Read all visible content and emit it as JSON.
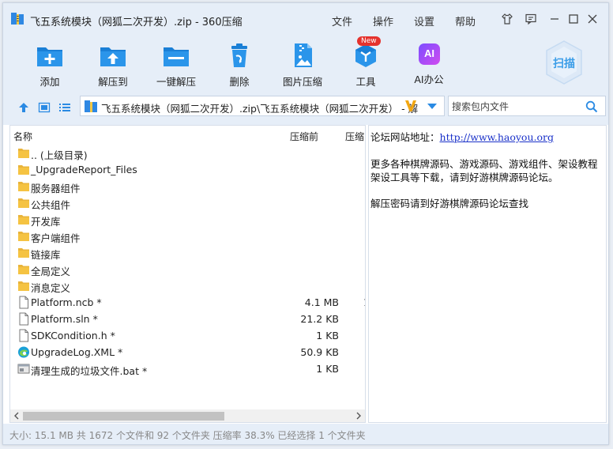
{
  "window": {
    "title": "飞五系统模块（网狐二次开发）.zip - 360压缩",
    "menus": [
      "文件",
      "操作",
      "设置",
      "帮助"
    ]
  },
  "toolbar": {
    "items": [
      {
        "label": "添加",
        "icon": "add-icon"
      },
      {
        "label": "解压到",
        "icon": "extract-to-icon"
      },
      {
        "label": "一键解压",
        "icon": "one-click-extract-icon"
      },
      {
        "label": "删除",
        "icon": "trash-icon"
      },
      {
        "label": "图片压缩",
        "icon": "image-compress-icon"
      },
      {
        "label": "工具",
        "icon": "tools-icon",
        "badge": "New"
      },
      {
        "label": "AI办公",
        "icon": "ai-office-icon",
        "icon_text": "AI"
      }
    ],
    "scan_label": "扫描"
  },
  "address": {
    "path": "飞五系统模块（网狐二次开发）.zip\\飞五系统模块（网狐二次开发） - 解",
    "search_placeholder": "搜索包内文件"
  },
  "file_list": {
    "columns": [
      "名称",
      "压缩前",
      "压缩"
    ],
    "rows": [
      {
        "name": ".. (上级目录)",
        "size": "",
        "type": "folder"
      },
      {
        "name": "_UpgradeReport_Files",
        "size": "",
        "type": "folder"
      },
      {
        "name": "服务器组件",
        "size": "",
        "type": "folder"
      },
      {
        "name": "公共组件",
        "size": "",
        "type": "folder"
      },
      {
        "name": "开发库",
        "size": "",
        "type": "folder"
      },
      {
        "name": "客户端组件",
        "size": "",
        "type": "folder"
      },
      {
        "name": "链接库",
        "size": "",
        "type": "folder"
      },
      {
        "name": "全局定义",
        "size": "",
        "type": "folder"
      },
      {
        "name": "消息定义",
        "size": "",
        "type": "folder"
      },
      {
        "name": "Platform.ncb *",
        "size": "4.1 MB",
        "type": "file",
        "cut": "1"
      },
      {
        "name": "Platform.sln *",
        "size": "21.2 KB",
        "type": "file"
      },
      {
        "name": "SDKCondition.h *",
        "size": "1 KB",
        "type": "file"
      },
      {
        "name": "UpgradeLog.XML *",
        "size": "50.9 KB",
        "type": "edge"
      },
      {
        "name": "清理生成的垃圾文件.bat *",
        "size": "1 KB",
        "type": "bat"
      }
    ]
  },
  "info_panel": {
    "forum_label": "论坛网站地址：",
    "forum_url": "http://www.haoyou.org",
    "line2": "更多各种棋牌源码、游戏源码、游戏组件、架设教程",
    "line3": "架设工具等下载，请到好游棋牌源码论坛。",
    "line4": "解压密码请到好游棋牌源码论坛查找"
  },
  "status": {
    "text": "大小: 15.1 MB 共 1672 个文件和 92 个文件夹 压缩率 38.3% 已经选择 1 个文件夹"
  },
  "colors": {
    "accent": "#1a7fd6",
    "folder": "#f5c342",
    "chrome": "#e6eef8"
  }
}
